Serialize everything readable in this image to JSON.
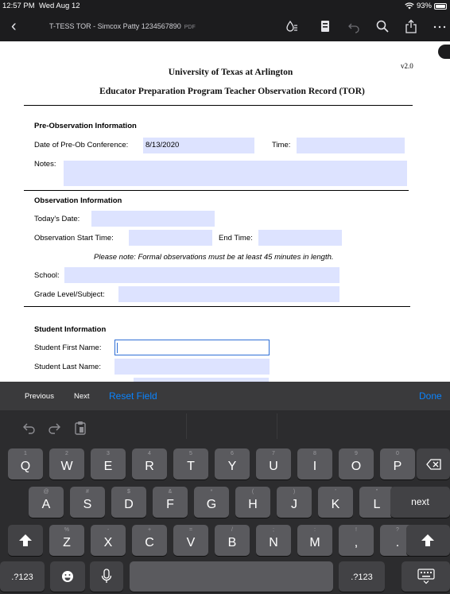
{
  "status_bar": {
    "time": "12:57 PM",
    "date": "Wed Aug 12",
    "battery": "93%",
    "battery_level": 0.93
  },
  "toolbar": {
    "title": "T-TESS TOR - Simcox Patty 1234567890",
    "file_type": "PDF"
  },
  "document": {
    "version": "v2.0",
    "university": "University of Texas at Arlington",
    "subtitle": "Educator Preparation Program Teacher Observation Record (TOR)",
    "pre_observation": {
      "heading": "Pre-Observation Information",
      "date_label": "Date of Pre-Ob Conference:",
      "date_value": "8/13/2020",
      "time_label": "Time:",
      "time_value": "",
      "notes_label": "Notes:",
      "notes_value": ""
    },
    "observation": {
      "heading": "Observation Information",
      "today_label": "Today's Date:",
      "today_value": "",
      "start_label": "Observation Start Time:",
      "start_value": "",
      "end_label": "End Time:",
      "end_value": "",
      "note": "Please note: Formal observations must be at least 45 minutes in length.",
      "school_label": "School:",
      "school_value": "",
      "grade_label": "Grade Level/Subject:",
      "grade_value": ""
    },
    "student": {
      "heading": "Student Information",
      "first_label": "Student First Name:",
      "first_value": "",
      "last_label": "Student Last Name:",
      "last_value": ""
    }
  },
  "keyboard_toolbar": {
    "previous": "Previous",
    "next": "Next",
    "reset": "Reset Field",
    "done": "Done"
  },
  "keyboard": {
    "row1": [
      {
        "main": "Q",
        "alt": "1"
      },
      {
        "main": "W",
        "alt": "2"
      },
      {
        "main": "E",
        "alt": "3"
      },
      {
        "main": "R",
        "alt": "4"
      },
      {
        "main": "T",
        "alt": "5"
      },
      {
        "main": "Y",
        "alt": "6"
      },
      {
        "main": "U",
        "alt": "7"
      },
      {
        "main": "I",
        "alt": "8"
      },
      {
        "main": "O",
        "alt": "9"
      },
      {
        "main": "P",
        "alt": "0"
      }
    ],
    "row2": [
      {
        "main": "A",
        "alt": "@"
      },
      {
        "main": "S",
        "alt": "#"
      },
      {
        "main": "D",
        "alt": "$"
      },
      {
        "main": "F",
        "alt": "&"
      },
      {
        "main": "G",
        "alt": "*"
      },
      {
        "main": "H",
        "alt": "("
      },
      {
        "main": "J",
        "alt": ")"
      },
      {
        "main": "K",
        "alt": "’"
      },
      {
        "main": "L",
        "alt": "\""
      }
    ],
    "row3": [
      {
        "main": "Z",
        "alt": "%"
      },
      {
        "main": "X",
        "alt": "-"
      },
      {
        "main": "C",
        "alt": "+"
      },
      {
        "main": "V",
        "alt": "="
      },
      {
        "main": "B",
        "alt": "/"
      },
      {
        "main": "N",
        "alt": ";"
      },
      {
        "main": "M",
        "alt": ":"
      },
      {
        "main": ",",
        "alt": "!"
      },
      {
        "main": ".",
        "alt": "?"
      }
    ],
    "return_label": "next",
    "numbers_label": ".?123",
    "icons": [
      "undo-icon",
      "redo-icon",
      "paste-icon",
      "delete-icon",
      "shift-icon",
      "emoji-icon",
      "microphone-icon",
      "hide-keyboard-icon"
    ]
  }
}
